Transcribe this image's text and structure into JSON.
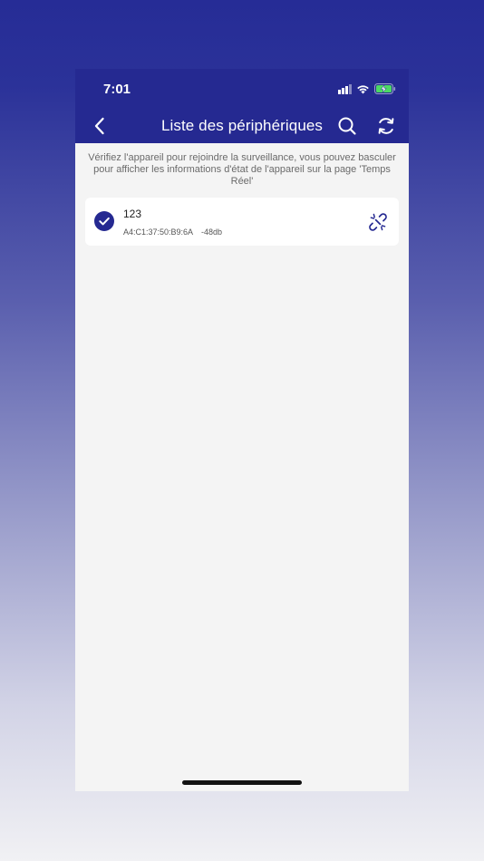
{
  "status_bar": {
    "time": "7:01"
  },
  "nav": {
    "title": "Liste des périphériques",
    "back_icon": "chevron-left-icon",
    "search_icon": "search-icon",
    "refresh_icon": "refresh-icon"
  },
  "hint": "Vérifiez l'appareil pour rejoindre la surveillance, vous pouvez basculer pour afficher les informations d'état de l'appareil sur la page 'Temps Réel'",
  "devices": [
    {
      "name": "123",
      "mac": "A4:C1:37:50:B9:6A",
      "rssi": "-48db",
      "selected": true,
      "action_icon": "unlink-icon"
    }
  ],
  "colors": {
    "primary": "#252991",
    "background": "#f4f4f4",
    "battery": "#4cd964"
  }
}
